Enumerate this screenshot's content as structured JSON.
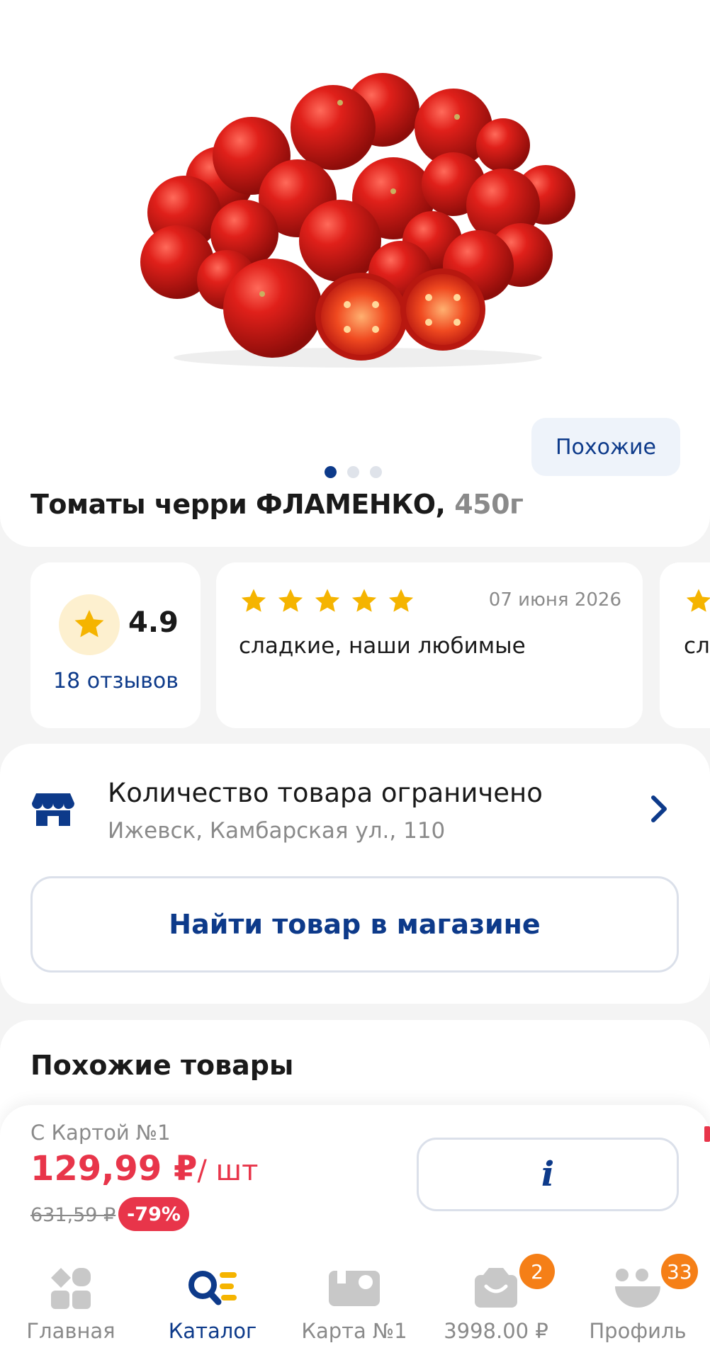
{
  "product": {
    "title": "Томаты черри ФЛАМЕНКО,",
    "weight": "450г",
    "similar_chip": "Похожие",
    "gallery": {
      "count": 3,
      "active": 1
    }
  },
  "rating": {
    "value": "4.9",
    "reviews_link": "18 отзывов",
    "star_color": "#f5b400"
  },
  "reviews": [
    {
      "stars": 5,
      "date": "07 июня 2026",
      "text": "сладкие, наши любимые"
    },
    {
      "stars": 5,
      "date": "",
      "text": "сл"
    }
  ],
  "store": {
    "title": "Количество товара ограничено",
    "address": "Ижевск, Камбарская ул., 110",
    "find_button": "Найти товар в магазине"
  },
  "similar": {
    "title": "Похожие товары"
  },
  "price": {
    "card_label": "С Картой №1",
    "current": "129,99 ₽",
    "unit": "/ шт",
    "old": "631,59 ₽",
    "discount": "-79%",
    "info_button": "i"
  },
  "nav": {
    "items": [
      {
        "label": "Главная",
        "icon": "home-tiles-icon",
        "active": false
      },
      {
        "label": "Каталог",
        "icon": "catalog-search-icon",
        "active": true
      },
      {
        "label": "Карта №1",
        "icon": "loyalty-card-icon",
        "active": false
      },
      {
        "label": "3998.00 ₽",
        "icon": "cart-bag-icon",
        "badge": "2",
        "active": false
      },
      {
        "label": "Профиль",
        "icon": "profile-face-icon",
        "badge": "33",
        "active": false
      }
    ]
  },
  "colors": {
    "brand_blue": "#0d3a8a",
    "price_red": "#e8354a",
    "badge_orange": "#f57f17"
  }
}
